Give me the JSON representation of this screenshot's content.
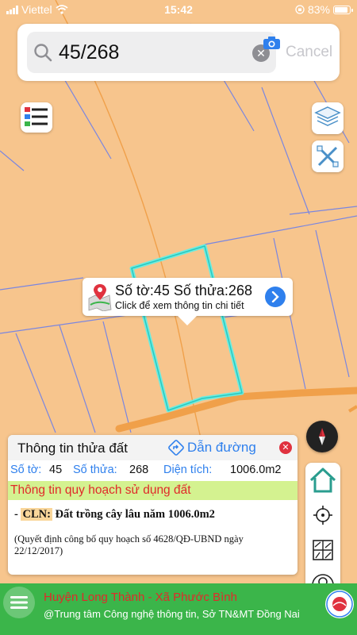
{
  "status_bar": {
    "carrier": "Viettel",
    "time": "15:42",
    "battery": "83%"
  },
  "search": {
    "value": "45/268",
    "placeholder": "",
    "cancel_label": "Cancel"
  },
  "popup": {
    "title": "Số tờ:45 Số thửa:268",
    "subtitle": "Click để xem thông tin chi tiết"
  },
  "info_panel": {
    "title": "Thông tin thửa đất",
    "directions_label": "Dẫn đường",
    "close_label": "✕",
    "sheet_label": "Số tờ:",
    "sheet_value": "45",
    "parcel_label": "Số thửa:",
    "parcel_value": "268",
    "area_label": "Diện tích:",
    "area_value": "1006.0m2",
    "planning_heading": "Thông tin quy hoạch sử dụng đất",
    "cln_prefix": "- ",
    "cln_code": "CLN:",
    "cln_text": " Đất trồng cây lâu năm 1006.0m2",
    "decision": "(Quyết định công bố quy hoạch số 4628/QĐ-UBND ngày 22/12/2017)"
  },
  "footer": {
    "line1": "Huyện Long Thành - Xã Phước Bình",
    "line2": "@Trung tâm Công nghệ thông tin, Sở TN&MT Đồng Nai"
  },
  "colors": {
    "map_bg": "#f7c58d",
    "parcel_line": "#7a86e0",
    "road": "#f0a04a",
    "highlight": "#5ef0e8",
    "accent_blue": "#2f80ed",
    "footer_green": "#3bb54a",
    "planning_green": "#d4f290",
    "alert_red": "#e02a2a"
  },
  "icons": {
    "search": "search-icon",
    "camera": "camera-icon",
    "legend": "legend-list-icon",
    "layers": "layers-icon",
    "measure": "measure-tools-icon",
    "compass": "compass-icon",
    "home": "home-icon",
    "locate": "locate-icon",
    "grid": "parcel-grid-icon",
    "user": "user-icon",
    "menu": "menu-icon"
  }
}
